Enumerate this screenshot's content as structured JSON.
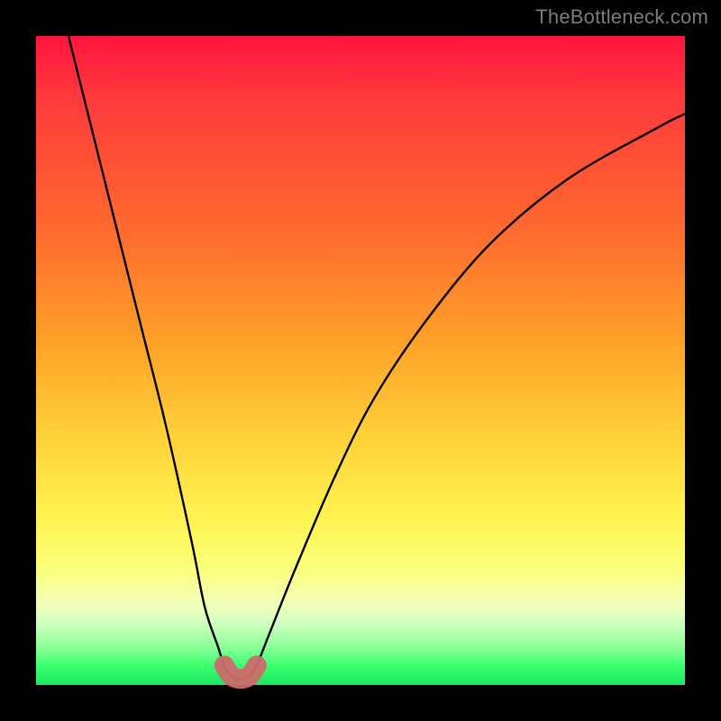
{
  "watermark": "TheBottleneck.com",
  "chart_data": {
    "type": "line",
    "title": "",
    "xlabel": "",
    "ylabel": "",
    "xlim": [
      0,
      100
    ],
    "ylim": [
      0,
      100
    ],
    "grid": false,
    "legend": false,
    "series": [
      {
        "name": "bottleneck-curve",
        "color": "#000000",
        "x": [
          5,
          8,
          12,
          16,
          20,
          24,
          26,
          28,
          29,
          30,
          31,
          32,
          33,
          34,
          36,
          40,
          46,
          52,
          60,
          70,
          82,
          96,
          100
        ],
        "values": [
          100,
          88,
          72,
          56,
          40,
          22,
          12,
          6,
          3,
          1.5,
          1,
          1,
          1.5,
          3,
          8,
          18,
          32,
          44,
          56,
          68,
          78,
          86,
          88
        ]
      }
    ],
    "annotations": [
      {
        "type": "marker-segment",
        "color": "#cc6b6b",
        "thickness": 22,
        "x": [
          29,
          30,
          31,
          32,
          33,
          34
        ],
        "values": [
          3,
          1.5,
          1,
          1,
          1.5,
          3
        ]
      }
    ],
    "background_gradient": {
      "direction": "vertical",
      "stops": [
        {
          "pos": 0,
          "color": "#ff143f"
        },
        {
          "pos": 30,
          "color": "#ff6a2f"
        },
        {
          "pos": 62,
          "color": "#ffd23a"
        },
        {
          "pos": 82,
          "color": "#fbff7a"
        },
        {
          "pos": 100,
          "color": "#18e860"
        }
      ]
    }
  }
}
